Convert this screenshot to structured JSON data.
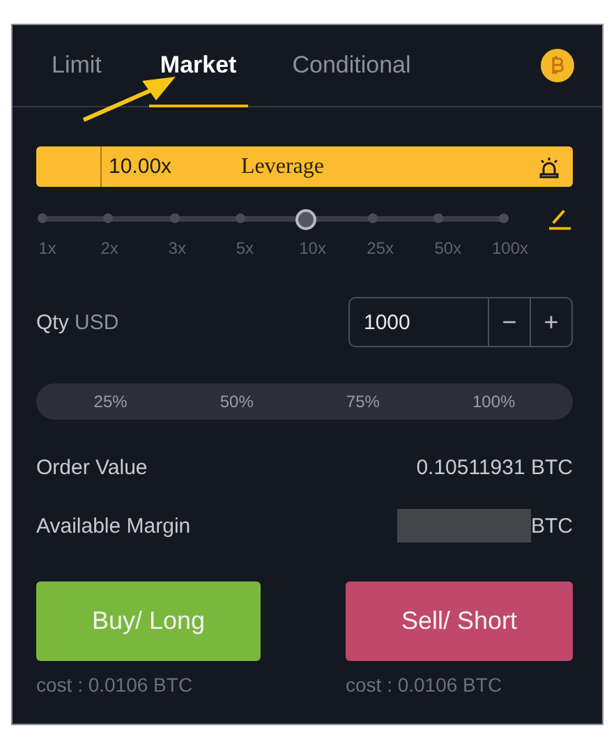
{
  "tabs": [
    {
      "label": "Limit",
      "selected": false
    },
    {
      "label": "Market",
      "selected": true
    },
    {
      "label": "Conditional",
      "selected": false
    }
  ],
  "leverage": {
    "value": "10.00x",
    "label": "Leverage"
  },
  "slider": {
    "level": 0.5714,
    "ticks": [
      "1x",
      "2x",
      "3x",
      "5x",
      "10x",
      "25x",
      "50x",
      "100x"
    ]
  },
  "qty": {
    "label": "Qty",
    "unit": "USD",
    "value": "1000",
    "minus": "−",
    "plus": "+"
  },
  "percent_options": [
    "25%",
    "50%",
    "75%",
    "100%"
  ],
  "order_value": {
    "label": "Order Value",
    "value": "0.10511931 BTC"
  },
  "available_margin": {
    "label": "Available Margin",
    "unit": "BTC"
  },
  "buttons": [
    {
      "label": "Buy/ Long",
      "kind": "buy",
      "cost": "cost : 0.0106 BTC"
    },
    {
      "label": "Sell/ Short",
      "kind": "sell",
      "cost": "cost : 0.0106 BTC"
    }
  ]
}
